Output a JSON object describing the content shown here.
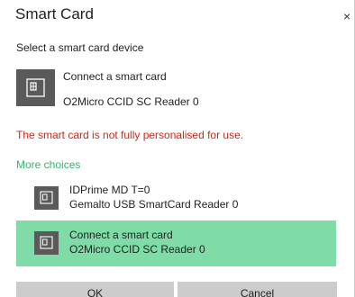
{
  "dialog": {
    "title": "Smart Card",
    "close_label": "×",
    "subtitle": "Select a smart card device"
  },
  "primary": {
    "title": "Connect a smart card",
    "subtitle": "O2Micro CCID SC Reader 0",
    "icon": "smart-card-icon"
  },
  "error": "The smart card is not fully personalised for use.",
  "more_choices": "More choices",
  "choices": [
    {
      "line1": "IDPrime MD T=0",
      "line2": "Gemalto USB SmartCard Reader 0",
      "selected": false,
      "icon": "smart-card-icon"
    },
    {
      "line1": "Connect a smart card",
      "line2": "O2Micro CCID SC Reader 0",
      "selected": true,
      "icon": "smart-card-icon"
    }
  ],
  "buttons": {
    "ok": "OK",
    "cancel": "Cancel"
  },
  "colors": {
    "error": "#c42b1c",
    "accent_link": "#2db86b",
    "selected_bg": "#7fdca6",
    "icon_bg": "#5a5a5a",
    "button_bg": "#cccccc"
  }
}
